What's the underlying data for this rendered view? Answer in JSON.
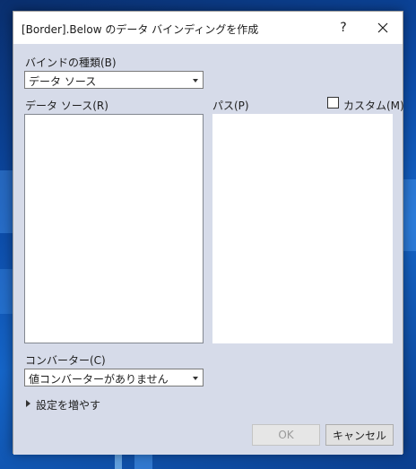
{
  "window": {
    "title": "[Border].Below のデータ バインディングを作成",
    "help_label": "?"
  },
  "binding_type": {
    "label": "バインドの種類(B)",
    "selected": "データ ソース"
  },
  "data_source": {
    "label": "データ ソース(R)"
  },
  "path": {
    "label": "パス(P)",
    "custom_label": "カスタム(M)",
    "custom_checked": false
  },
  "converter": {
    "label": "コンバーター(C)",
    "selected": "値コンバーターがありません"
  },
  "more_settings": {
    "label": "設定を増やす"
  },
  "buttons": {
    "ok_label": "OK",
    "cancel_label": "キャンセル"
  },
  "icons": {
    "close": "close-icon",
    "dropdown": "chevron-down-icon",
    "expander": "triangle-right-icon"
  }
}
